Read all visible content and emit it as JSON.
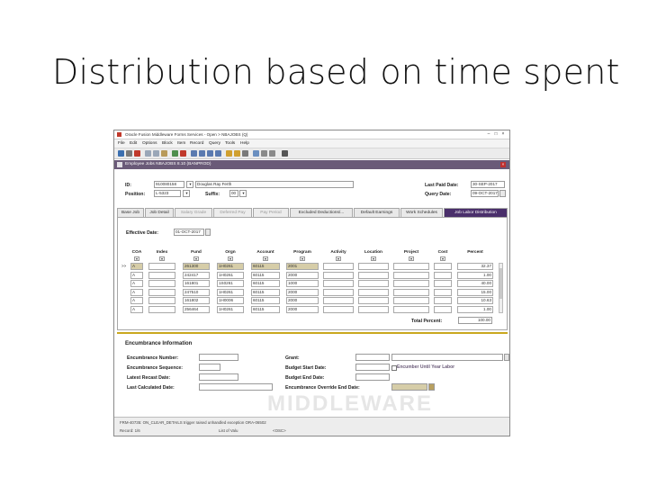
{
  "slide": {
    "title": "Distribution based on time spent"
  },
  "window": {
    "title": "Oracle Fusion Middleware Forms Services - Open > NBAJOBS (Q)",
    "menu": [
      "File",
      "Edit",
      "Options",
      "Block",
      "Item",
      "Record",
      "Query",
      "Tools",
      "Help"
    ]
  },
  "form": {
    "title": "Employee Jobs  NBAJOBS  8.10  (BANPROD)"
  },
  "key": {
    "id_label": "ID:",
    "id_value": "910080158",
    "name_value": "Douglas Ray Ferth",
    "position_label": "Position:",
    "position_value": "L-5323",
    "suffix_label": "Suffix:",
    "suffix_value": "00",
    "last_paid_label": "Last Paid Date:",
    "last_paid_value": "30-SEP-2017",
    "query_date_label": "Query Date:",
    "query_date_value": "09-OCT-2017"
  },
  "tabs": [
    {
      "label": "Base Job",
      "state": "normal"
    },
    {
      "label": "Job Detail",
      "state": "normal"
    },
    {
      "label": "Salary Grade",
      "state": "dim"
    },
    {
      "label": "Deferred Pay",
      "state": "dim"
    },
    {
      "label": "Pay Period",
      "state": "dim"
    },
    {
      "label": "Excluded Deductions/...",
      "state": "normal"
    },
    {
      "label": "Default Earnings",
      "state": "normal"
    },
    {
      "label": "Work Schedules",
      "state": "normal"
    },
    {
      "label": "Job Labor Distribution",
      "state": "selected"
    }
  ],
  "labor": {
    "effective_label": "Effective Date:",
    "effective_value": "01-OCT-2017",
    "columns": [
      "COA",
      "Index",
      "Fund",
      "Orgn",
      "Account",
      "Program",
      "Activity",
      "Location",
      "Project",
      "Cost",
      "Percent"
    ],
    "rows": [
      [
        "A",
        "",
        "261300",
        "1H0261",
        "60115",
        "2001",
        "",
        "",
        "",
        "",
        "32.37"
      ],
      [
        "A",
        "",
        "242417",
        "1H0261",
        "60115",
        "2000",
        "",
        "",
        "",
        "",
        "1.00"
      ],
      [
        "A",
        "",
        "161801",
        "1S0261",
        "60115",
        "1000",
        "",
        "",
        "",
        "",
        "40.00"
      ],
      [
        "A",
        "",
        "247510",
        "1H0261",
        "60115",
        "2000",
        "",
        "",
        "",
        "",
        "15.00"
      ],
      [
        "A",
        "",
        "161802",
        "1H0006",
        "60115",
        "2000",
        "",
        "",
        "",
        "",
        "10.63"
      ],
      [
        "A",
        "",
        "256464",
        "1H0261",
        "60115",
        "2000",
        "",
        "",
        "",
        "",
        "1.00"
      ]
    ],
    "total_label": "Total Percent:",
    "total_value": "100.00"
  },
  "encumbrance": {
    "title": "Encumbrance Information",
    "number_label": "Encumbrance Number:",
    "sequence_label": "Encumbrance Sequence:",
    "latest_recast_label": "Latest Recast Date:",
    "last_calculated_label": "Last Calculated Date:",
    "grant_label": "Grant:",
    "budget_start_label": "Budget Start Date:",
    "budget_end_label": "Budget End Date:",
    "override_label": "Encumbrance Override End Date:",
    "encumber_labor_label": "Encumber Until Year Labor"
  },
  "status": {
    "message": "FRM-40735: ON_CLEAR_DETAILS trigger raised unhandled exception ORA-06502",
    "record": "Record: 1/6",
    "list": "List of Valu",
    "osc": "<OSC>"
  },
  "watermark": "MIDDLEWARE"
}
